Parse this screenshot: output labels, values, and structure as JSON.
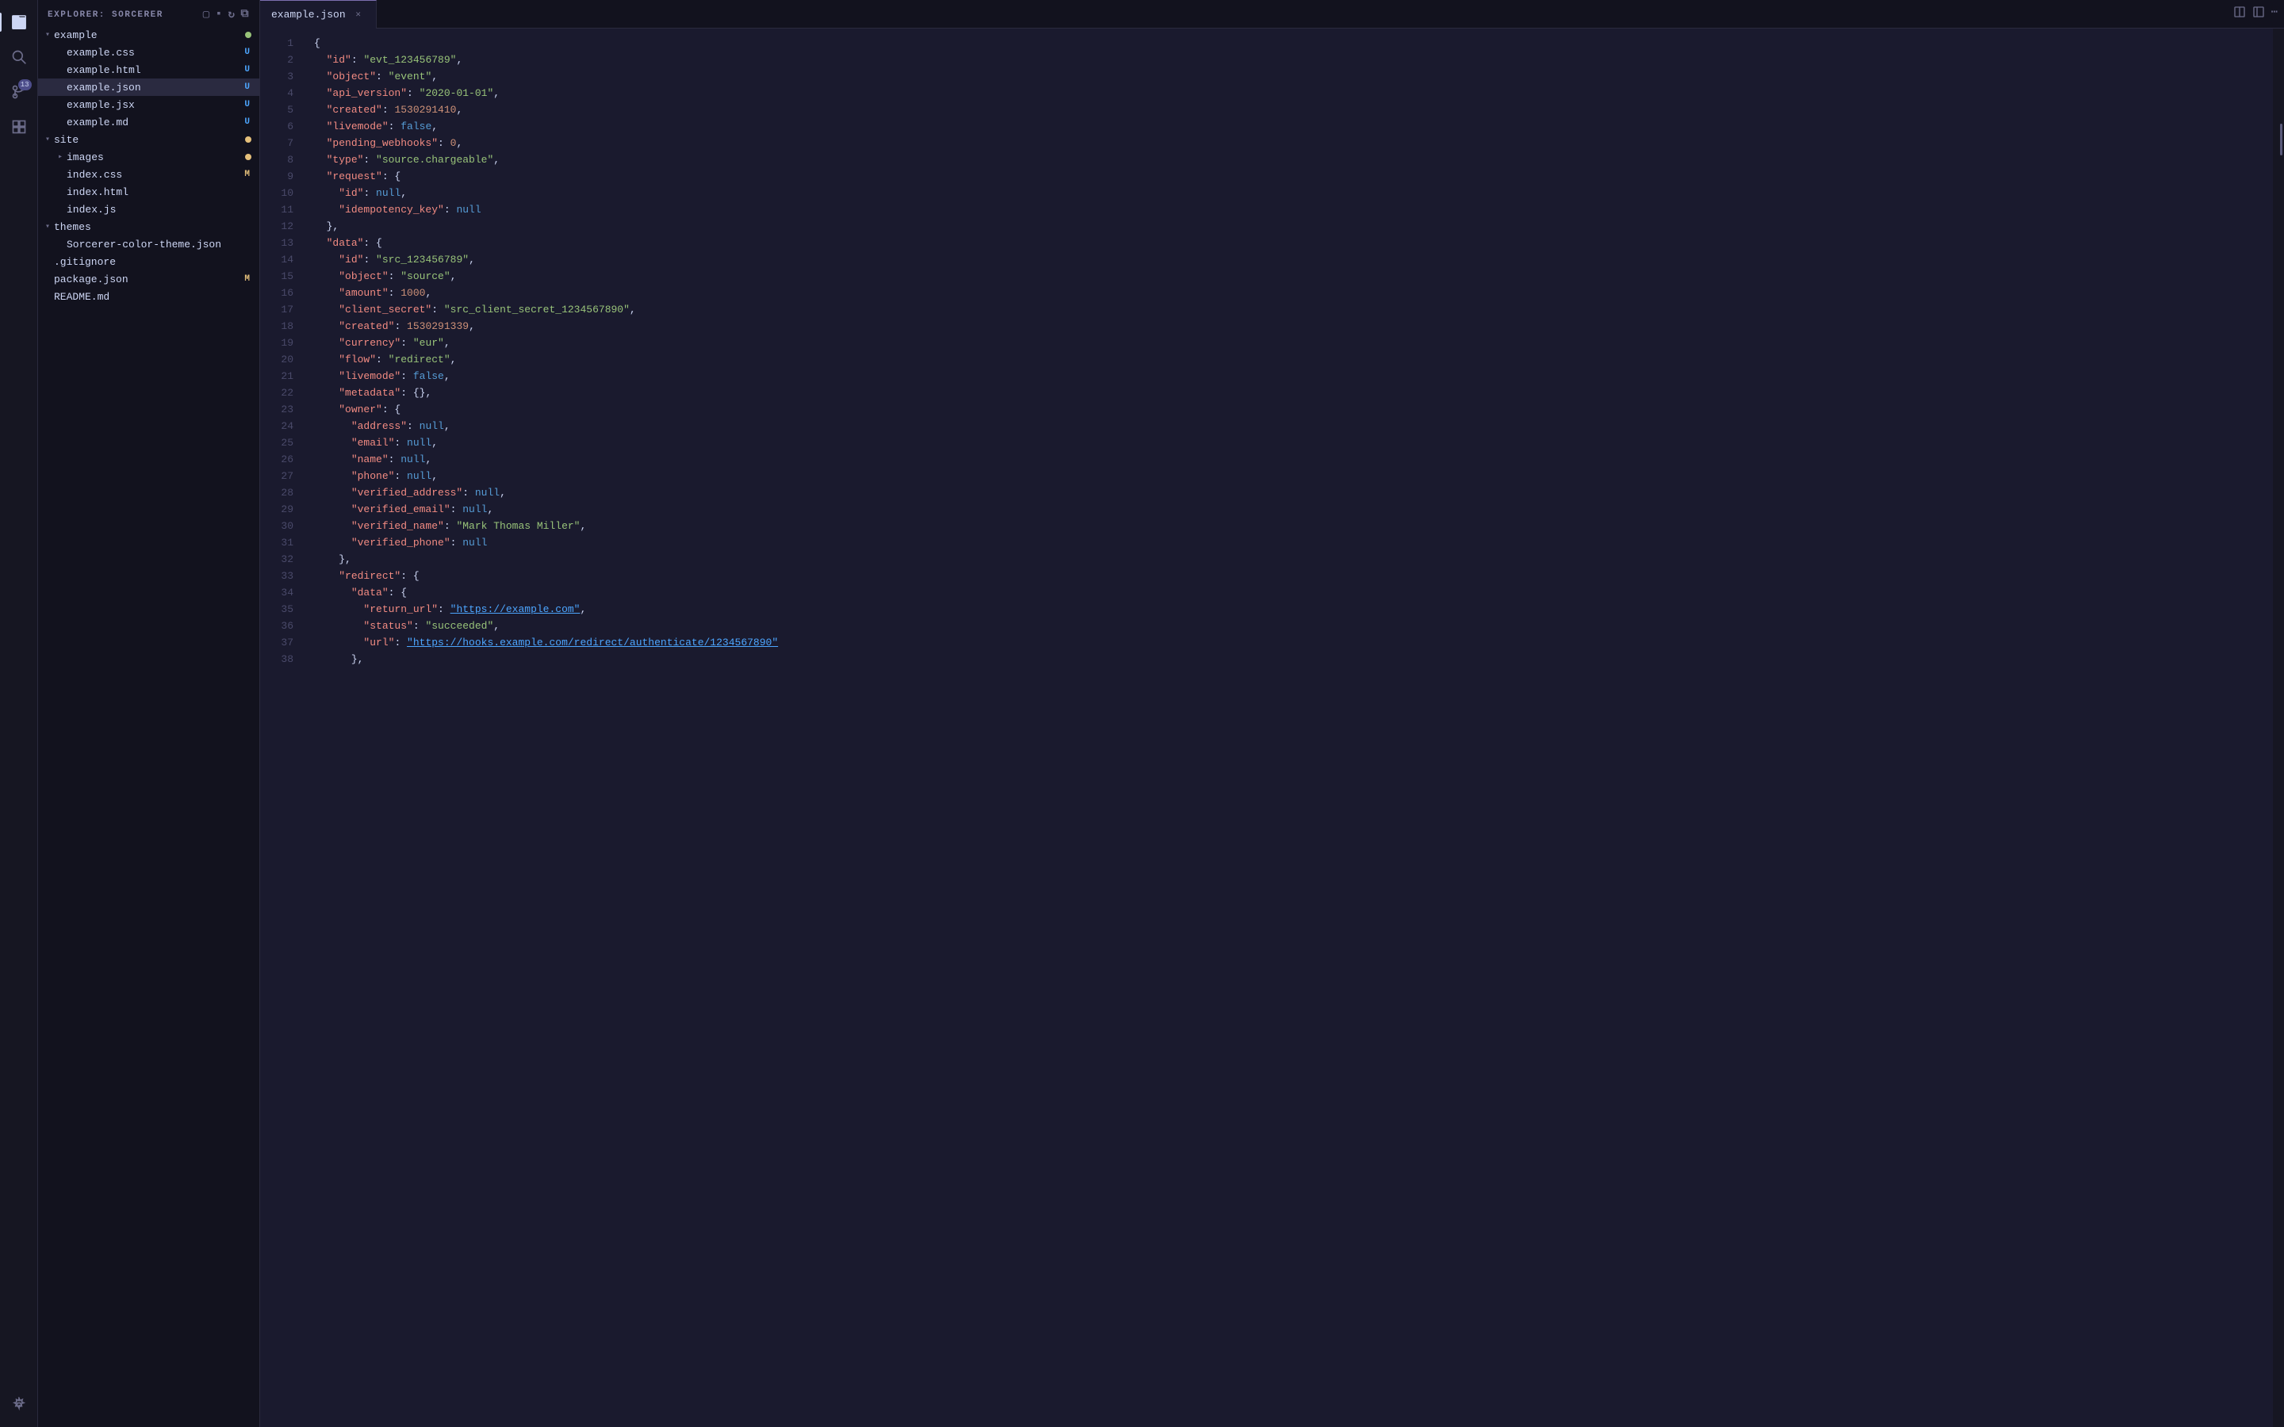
{
  "activityBar": {
    "icons": [
      {
        "name": "files-icon",
        "symbol": "⬜",
        "active": true,
        "badge": null
      },
      {
        "name": "search-icon",
        "symbol": "🔍",
        "active": false,
        "badge": null
      },
      {
        "name": "source-control-icon",
        "symbol": "⑂",
        "active": false,
        "badge": "13"
      },
      {
        "name": "extensions-icon",
        "symbol": "⊞",
        "active": false,
        "badge": null
      },
      {
        "name": "settings-icon",
        "symbol": "⚙",
        "active": false,
        "badge": null
      }
    ]
  },
  "sidebar": {
    "title": "EXPLORER: SORCERER",
    "headerIcons": [
      "new-file",
      "new-folder",
      "refresh",
      "collapse"
    ],
    "tree": [
      {
        "id": "example-folder",
        "label": "example",
        "type": "folder",
        "expanded": true,
        "depth": 0,
        "badge": "dot-green"
      },
      {
        "id": "example-css",
        "label": "example.css",
        "type": "file",
        "depth": 1,
        "badge": "U"
      },
      {
        "id": "example-html",
        "label": "example.html",
        "type": "file",
        "depth": 1,
        "badge": "U"
      },
      {
        "id": "example-json",
        "label": "example.json",
        "type": "file",
        "depth": 1,
        "badge": "U",
        "active": true
      },
      {
        "id": "example-jsx",
        "label": "example.jsx",
        "type": "file",
        "depth": 1,
        "badge": "U"
      },
      {
        "id": "example-md",
        "label": "example.md",
        "type": "file",
        "depth": 1,
        "badge": "U"
      },
      {
        "id": "site-folder",
        "label": "site",
        "type": "folder",
        "expanded": true,
        "depth": 0,
        "badge": "dot-yellow"
      },
      {
        "id": "images-folder",
        "label": "images",
        "type": "folder",
        "expanded": false,
        "depth": 1,
        "badge": "dot-yellow"
      },
      {
        "id": "index-css",
        "label": "index.css",
        "type": "file",
        "depth": 1,
        "badge": "M"
      },
      {
        "id": "index-html",
        "label": "index.html",
        "type": "file",
        "depth": 1,
        "badge": null
      },
      {
        "id": "index-js",
        "label": "index.js",
        "type": "file",
        "depth": 1,
        "badge": null
      },
      {
        "id": "themes-folder",
        "label": "themes",
        "type": "folder",
        "expanded": true,
        "depth": 0,
        "badge": null
      },
      {
        "id": "sorcerer-theme",
        "label": "Sorcerer-color-theme.json",
        "type": "file",
        "depth": 1,
        "badge": null
      },
      {
        "id": "gitignore",
        "label": ".gitignore",
        "type": "file",
        "depth": 0,
        "badge": null
      },
      {
        "id": "package-json",
        "label": "package.json",
        "type": "file",
        "depth": 0,
        "badge": "M"
      },
      {
        "id": "readme-md",
        "label": "README.md",
        "type": "file",
        "depth": 0,
        "badge": null
      }
    ]
  },
  "tabs": [
    {
      "id": "example-json-tab",
      "label": "example.json",
      "active": true,
      "modified": false
    }
  ],
  "editor": {
    "filename": "example.json",
    "lines": [
      {
        "n": 1,
        "tokens": [
          {
            "t": "{",
            "c": "punct"
          }
        ]
      },
      {
        "n": 2,
        "tokens": [
          {
            "t": "  ",
            "c": ""
          },
          {
            "t": "\"id\"",
            "c": "key"
          },
          {
            "t": ": ",
            "c": "punct"
          },
          {
            "t": "\"evt_123456789\"",
            "c": "str"
          },
          {
            "t": ",",
            "c": "punct"
          }
        ]
      },
      {
        "n": 3,
        "tokens": [
          {
            "t": "  ",
            "c": ""
          },
          {
            "t": "\"object\"",
            "c": "key"
          },
          {
            "t": ": ",
            "c": "punct"
          },
          {
            "t": "\"event\"",
            "c": "str"
          },
          {
            "t": ",",
            "c": "punct"
          }
        ]
      },
      {
        "n": 4,
        "tokens": [
          {
            "t": "  ",
            "c": ""
          },
          {
            "t": "\"api_version\"",
            "c": "key"
          },
          {
            "t": ": ",
            "c": "punct"
          },
          {
            "t": "\"2020-01-01\"",
            "c": "str"
          },
          {
            "t": ",",
            "c": "punct"
          }
        ]
      },
      {
        "n": 5,
        "tokens": [
          {
            "t": "  ",
            "c": ""
          },
          {
            "t": "\"created\"",
            "c": "key"
          },
          {
            "t": ": ",
            "c": "punct"
          },
          {
            "t": "1530291410",
            "c": "num"
          },
          {
            "t": ",",
            "c": "punct"
          }
        ]
      },
      {
        "n": 6,
        "tokens": [
          {
            "t": "  ",
            "c": ""
          },
          {
            "t": "\"livemode\"",
            "c": "key"
          },
          {
            "t": ": ",
            "c": "punct"
          },
          {
            "t": "false",
            "c": "bool"
          },
          {
            "t": ",",
            "c": "punct"
          }
        ]
      },
      {
        "n": 7,
        "tokens": [
          {
            "t": "  ",
            "c": ""
          },
          {
            "t": "\"pending_webhooks\"",
            "c": "key"
          },
          {
            "t": ": ",
            "c": "punct"
          },
          {
            "t": "0",
            "c": "num"
          },
          {
            "t": ",",
            "c": "punct"
          }
        ]
      },
      {
        "n": 8,
        "tokens": [
          {
            "t": "  ",
            "c": ""
          },
          {
            "t": "\"type\"",
            "c": "key"
          },
          {
            "t": ": ",
            "c": "punct"
          },
          {
            "t": "\"source.chargeable\"",
            "c": "str"
          },
          {
            "t": ",",
            "c": "punct"
          }
        ]
      },
      {
        "n": 9,
        "tokens": [
          {
            "t": "  ",
            "c": ""
          },
          {
            "t": "\"request\"",
            "c": "key"
          },
          {
            "t": ": {",
            "c": "punct"
          }
        ]
      },
      {
        "n": 10,
        "tokens": [
          {
            "t": "    ",
            "c": ""
          },
          {
            "t": "\"id\"",
            "c": "key"
          },
          {
            "t": ": ",
            "c": "punct"
          },
          {
            "t": "null",
            "c": "null"
          },
          {
            "t": ",",
            "c": "punct"
          }
        ]
      },
      {
        "n": 11,
        "tokens": [
          {
            "t": "    ",
            "c": ""
          },
          {
            "t": "\"idempotency_key\"",
            "c": "key"
          },
          {
            "t": ": ",
            "c": "punct"
          },
          {
            "t": "null",
            "c": "null"
          }
        ]
      },
      {
        "n": 12,
        "tokens": [
          {
            "t": "  ",
            "c": ""
          },
          {
            "t": "},",
            "c": "punct"
          }
        ]
      },
      {
        "n": 13,
        "tokens": [
          {
            "t": "  ",
            "c": ""
          },
          {
            "t": "\"data\"",
            "c": "key"
          },
          {
            "t": ": {",
            "c": "punct"
          }
        ]
      },
      {
        "n": 14,
        "tokens": [
          {
            "t": "    ",
            "c": ""
          },
          {
            "t": "\"id\"",
            "c": "key"
          },
          {
            "t": ": ",
            "c": "punct"
          },
          {
            "t": "\"src_123456789\"",
            "c": "str"
          },
          {
            "t": ",",
            "c": "punct"
          }
        ]
      },
      {
        "n": 15,
        "tokens": [
          {
            "t": "    ",
            "c": ""
          },
          {
            "t": "\"object\"",
            "c": "key"
          },
          {
            "t": ": ",
            "c": "punct"
          },
          {
            "t": "\"source\"",
            "c": "str"
          },
          {
            "t": ",",
            "c": "punct"
          }
        ]
      },
      {
        "n": 16,
        "tokens": [
          {
            "t": "    ",
            "c": ""
          },
          {
            "t": "\"amount\"",
            "c": "key"
          },
          {
            "t": ": ",
            "c": "punct"
          },
          {
            "t": "1000",
            "c": "num"
          },
          {
            "t": ",",
            "c": "punct"
          }
        ]
      },
      {
        "n": 17,
        "tokens": [
          {
            "t": "    ",
            "c": ""
          },
          {
            "t": "\"client_secret\"",
            "c": "key"
          },
          {
            "t": ": ",
            "c": "punct"
          },
          {
            "t": "\"src_client_secret_1234567890\"",
            "c": "str"
          },
          {
            "t": ",",
            "c": "punct"
          }
        ]
      },
      {
        "n": 18,
        "tokens": [
          {
            "t": "    ",
            "c": ""
          },
          {
            "t": "\"created\"",
            "c": "key"
          },
          {
            "t": ": ",
            "c": "punct"
          },
          {
            "t": "1530291339",
            "c": "num"
          },
          {
            "t": ",",
            "c": "punct"
          }
        ]
      },
      {
        "n": 19,
        "tokens": [
          {
            "t": "    ",
            "c": ""
          },
          {
            "t": "\"currency\"",
            "c": "key"
          },
          {
            "t": ": ",
            "c": "punct"
          },
          {
            "t": "\"eur\"",
            "c": "str"
          },
          {
            "t": ",",
            "c": "punct"
          }
        ]
      },
      {
        "n": 20,
        "tokens": [
          {
            "t": "    ",
            "c": ""
          },
          {
            "t": "\"flow\"",
            "c": "key"
          },
          {
            "t": ": ",
            "c": "punct"
          },
          {
            "t": "\"redirect\"",
            "c": "str"
          },
          {
            "t": ",",
            "c": "punct"
          }
        ]
      },
      {
        "n": 21,
        "tokens": [
          {
            "t": "    ",
            "c": ""
          },
          {
            "t": "\"livemode\"",
            "c": "key"
          },
          {
            "t": ": ",
            "c": "punct"
          },
          {
            "t": "false",
            "c": "bool"
          },
          {
            "t": ",",
            "c": "punct"
          }
        ]
      },
      {
        "n": 22,
        "tokens": [
          {
            "t": "    ",
            "c": ""
          },
          {
            "t": "\"metadata\"",
            "c": "key"
          },
          {
            "t": ": {},",
            "c": "punct"
          }
        ]
      },
      {
        "n": 23,
        "tokens": [
          {
            "t": "    ",
            "c": ""
          },
          {
            "t": "\"owner\"",
            "c": "key"
          },
          {
            "t": ": {",
            "c": "punct"
          }
        ]
      },
      {
        "n": 24,
        "tokens": [
          {
            "t": "      ",
            "c": ""
          },
          {
            "t": "\"address\"",
            "c": "key"
          },
          {
            "t": ": ",
            "c": "punct"
          },
          {
            "t": "null",
            "c": "null"
          },
          {
            "t": ",",
            "c": "punct"
          }
        ]
      },
      {
        "n": 25,
        "tokens": [
          {
            "t": "      ",
            "c": ""
          },
          {
            "t": "\"email\"",
            "c": "key"
          },
          {
            "t": ": ",
            "c": "punct"
          },
          {
            "t": "null",
            "c": "null"
          },
          {
            "t": ",",
            "c": "punct"
          }
        ]
      },
      {
        "n": 26,
        "tokens": [
          {
            "t": "      ",
            "c": ""
          },
          {
            "t": "\"name\"",
            "c": "key"
          },
          {
            "t": ": ",
            "c": "punct"
          },
          {
            "t": "null",
            "c": "null"
          },
          {
            "t": ",",
            "c": "punct"
          }
        ]
      },
      {
        "n": 27,
        "tokens": [
          {
            "t": "      ",
            "c": ""
          },
          {
            "t": "\"phone\"",
            "c": "key"
          },
          {
            "t": ": ",
            "c": "punct"
          },
          {
            "t": "null",
            "c": "null"
          },
          {
            "t": ",",
            "c": "punct"
          }
        ]
      },
      {
        "n": 28,
        "tokens": [
          {
            "t": "      ",
            "c": ""
          },
          {
            "t": "\"verified_address\"",
            "c": "key"
          },
          {
            "t": ": ",
            "c": "punct"
          },
          {
            "t": "null",
            "c": "null"
          },
          {
            "t": ",",
            "c": "punct"
          }
        ]
      },
      {
        "n": 29,
        "tokens": [
          {
            "t": "      ",
            "c": ""
          },
          {
            "t": "\"verified_email\"",
            "c": "key"
          },
          {
            "t": ": ",
            "c": "punct"
          },
          {
            "t": "null",
            "c": "null"
          },
          {
            "t": ",",
            "c": "punct"
          }
        ]
      },
      {
        "n": 30,
        "tokens": [
          {
            "t": "      ",
            "c": ""
          },
          {
            "t": "\"verified_name\"",
            "c": "key"
          },
          {
            "t": ": ",
            "c": "punct"
          },
          {
            "t": "\"Mark Thomas Miller\"",
            "c": "str"
          },
          {
            "t": ",",
            "c": "punct"
          }
        ]
      },
      {
        "n": 31,
        "tokens": [
          {
            "t": "      ",
            "c": ""
          },
          {
            "t": "\"verified_phone\"",
            "c": "key"
          },
          {
            "t": ": ",
            "c": "punct"
          },
          {
            "t": "null",
            "c": "null"
          }
        ]
      },
      {
        "n": 32,
        "tokens": [
          {
            "t": "    ",
            "c": ""
          },
          {
            "t": "},",
            "c": "punct"
          }
        ]
      },
      {
        "n": 33,
        "tokens": [
          {
            "t": "    ",
            "c": ""
          },
          {
            "t": "\"redirect\"",
            "c": "key"
          },
          {
            "t": ": {",
            "c": "punct"
          }
        ]
      },
      {
        "n": 34,
        "tokens": [
          {
            "t": "      ",
            "c": ""
          },
          {
            "t": "\"data\"",
            "c": "key"
          },
          {
            "t": ": {",
            "c": "punct"
          }
        ]
      },
      {
        "n": 35,
        "tokens": [
          {
            "t": "        ",
            "c": ""
          },
          {
            "t": "\"return_url\"",
            "c": "key"
          },
          {
            "t": ": ",
            "c": "punct"
          },
          {
            "t": "\"https://example.com\"",
            "c": "url"
          },
          {
            "t": ",",
            "c": "punct"
          }
        ]
      },
      {
        "n": 36,
        "tokens": [
          {
            "t": "        ",
            "c": ""
          },
          {
            "t": "\"status\"",
            "c": "key"
          },
          {
            "t": ": ",
            "c": "punct"
          },
          {
            "t": "\"succeeded\"",
            "c": "str"
          },
          {
            "t": ",",
            "c": "punct"
          }
        ]
      },
      {
        "n": 37,
        "tokens": [
          {
            "t": "        ",
            "c": ""
          },
          {
            "t": "\"url\"",
            "c": "key"
          },
          {
            "t": ": ",
            "c": "punct"
          },
          {
            "t": "\"https://hooks.example.com/redirect/authenticate/1234567890\"",
            "c": "url"
          }
        ]
      },
      {
        "n": 38,
        "tokens": [
          {
            "t": "      ",
            "c": ""
          },
          {
            "t": "},",
            "c": "punct"
          }
        ]
      }
    ]
  }
}
